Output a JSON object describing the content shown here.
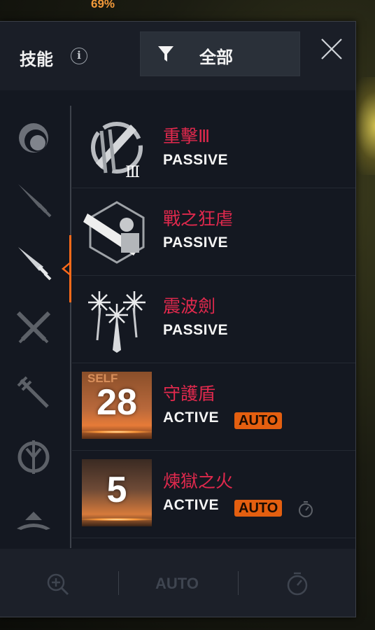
{
  "background": {
    "percent_text": "69%"
  },
  "header": {
    "title": "技能",
    "filter_label": "全部"
  },
  "skills": [
    {
      "name": "重擊Ⅲ",
      "type": "PASSIVE",
      "icon": "heavy-strike-icon"
    },
    {
      "name": "戰之狂虐",
      "type": "PASSIVE",
      "icon": "war-frenzy-icon"
    },
    {
      "name": "震波劍",
      "type": "PASSIVE",
      "icon": "shockwave-sword-icon"
    },
    {
      "name": "守護盾",
      "type": "ACTIVE",
      "auto": "AUTO",
      "cooldown": "28",
      "self_label": "SELF",
      "icon": "guardian-shield-icon"
    },
    {
      "name": "煉獄之火",
      "type": "ACTIVE",
      "auto": "AUTO",
      "cooldown": "5",
      "icon": "hellfire-icon"
    }
  ],
  "footer": {
    "auto_label": "AUTO"
  },
  "colors": {
    "accent": "#ff6a1a",
    "skill_name": "#e0294d",
    "auto_badge": "#e45f10",
    "panel_bg": "#141821"
  }
}
